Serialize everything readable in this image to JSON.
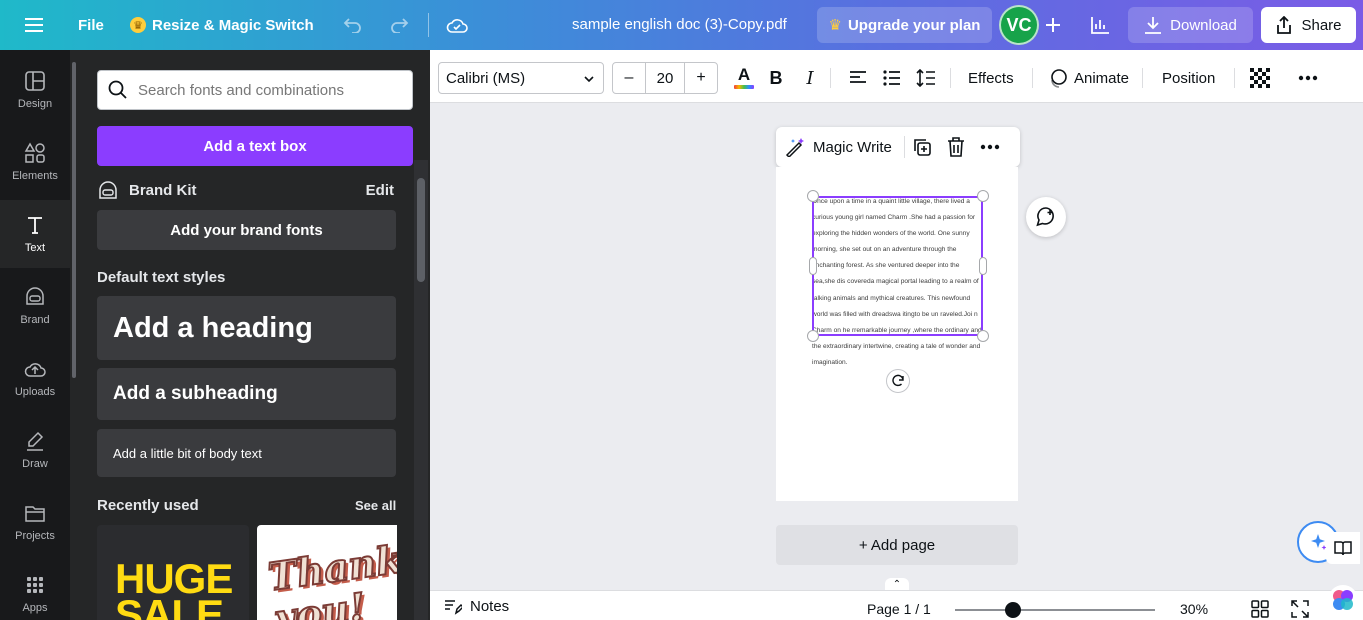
{
  "topbar": {
    "file": "File",
    "magic_switch": "Resize & Magic Switch",
    "doc_title": "sample english doc (3)-Copy.pdf",
    "upgrade": "Upgrade your plan",
    "avatar_initials": "VC",
    "download": "Download",
    "share": "Share"
  },
  "rail": {
    "items": [
      {
        "label": "Design",
        "icon": "design-icon"
      },
      {
        "label": "Elements",
        "icon": "elements-icon"
      },
      {
        "label": "Text",
        "icon": "text-icon",
        "active": true
      },
      {
        "label": "Brand",
        "icon": "brand-icon"
      },
      {
        "label": "Uploads",
        "icon": "uploads-icon"
      },
      {
        "label": "Draw",
        "icon": "draw-icon"
      },
      {
        "label": "Projects",
        "icon": "projects-icon"
      },
      {
        "label": "Apps",
        "icon": "apps-icon"
      }
    ]
  },
  "panel": {
    "search_placeholder": "Search fonts and combinations",
    "add_textbox": "Add a text box",
    "brand_kit": "Brand Kit",
    "brand_edit": "Edit",
    "brand_fonts": "Add your brand fonts",
    "default_styles": "Default text styles",
    "heading": "Add a heading",
    "subheading": "Add a subheading",
    "body": "Add a little bit of body text",
    "recently_used": "Recently used",
    "see_all": "See all",
    "recent_1_text": "HUGE SALE",
    "recent_2_text": "Thank you!"
  },
  "toolbar": {
    "font": "Calibri (MS)",
    "minus": "–",
    "size": "20",
    "plus": "+",
    "color_letter": "A",
    "bold": "B",
    "italic": "I",
    "effects": "Effects",
    "animate": "Animate",
    "position": "Position"
  },
  "canvas": {
    "magic_write": "Magic Write",
    "page_text": "Once upon a time in a quaint little village, there lived a curious young girl named Charm .She had a passion for exploring the hidden wonders of the world. One sunny morning, she set out on an adventure through the enchanting forest. As she ventured deeper into the sea,she dis covereda magical portal leading to a realm of talking animals and mythical creatures. This newfound world was filled with dreadswa itingto be un raveled.Joi n Charm on he rremarkable journey ,where the ordinary and the extraordinary intertwine, creating a tale of wonder and imagination.",
    "add_page": "+ Add page"
  },
  "footer": {
    "notes": "Notes",
    "page_info": "Page 1 / 1",
    "zoom": "30%",
    "zoom_fraction": 0.3
  },
  "colors": {
    "accent": "#8b3dff",
    "avatar": "#17a34a"
  }
}
